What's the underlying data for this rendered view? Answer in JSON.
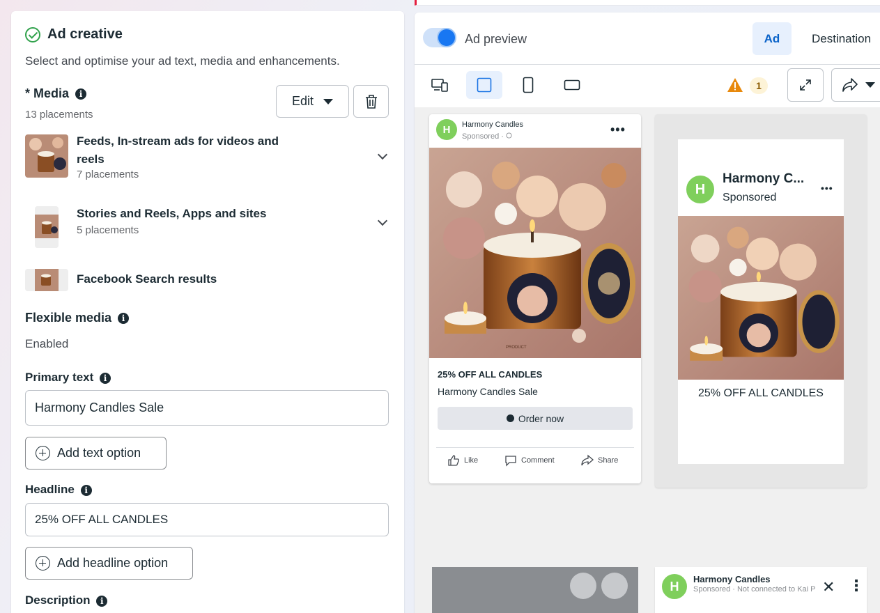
{
  "left_panel": {
    "title": "Ad creative",
    "subtitle": "Select and optimise your ad text, media and enhancements.",
    "media": {
      "label": "* Media",
      "count": "13 placements",
      "edit_label": "Edit",
      "placements": [
        {
          "title": "Feeds, In-stream ads for videos and reels",
          "count": "7 placements"
        },
        {
          "title": "Stories and Reels, Apps and sites",
          "count": "5 placements"
        },
        {
          "title": "Facebook Search results",
          "count": ""
        }
      ]
    },
    "flexible_media": {
      "label": "Flexible media",
      "value": "Enabled"
    },
    "primary_text": {
      "label": "Primary text",
      "value": "Harmony Candles Sale",
      "add_label": "Add text option"
    },
    "headline": {
      "label": "Headline",
      "value": "25% OFF ALL CANDLES",
      "add_label": "Add headline option"
    },
    "description": {
      "label": "Description"
    }
  },
  "right_panel": {
    "preview_label": "Ad preview",
    "tabs": [
      "Ad",
      "Destination"
    ],
    "warning_count": "1",
    "feed_card": {
      "page_name": "Harmony Candles",
      "sponsored": "Sponsored ·",
      "headline": "25% OFF ALL CANDLES",
      "primary_text": "Harmony Candles Sale",
      "cta": "Order now",
      "actions": [
        "Like",
        "Comment",
        "Share"
      ],
      "image_caption": "PRODUCT"
    },
    "story_card": {
      "page_name": "Harmony C...",
      "sponsored": "Sponsored",
      "headline": "25% OFF ALL CANDLES"
    },
    "bottom_card": {
      "page_name": "Harmony Candles",
      "sub": "Sponsored · Not connected to Kai Plus · ",
      "close": "✕",
      "more": "⋮"
    },
    "avatar_letter": "H"
  },
  "colors": {
    "accent": "#1877f2",
    "success": "#31a24c",
    "warning": "#e8890c",
    "avatar": "#7fcf5c"
  }
}
